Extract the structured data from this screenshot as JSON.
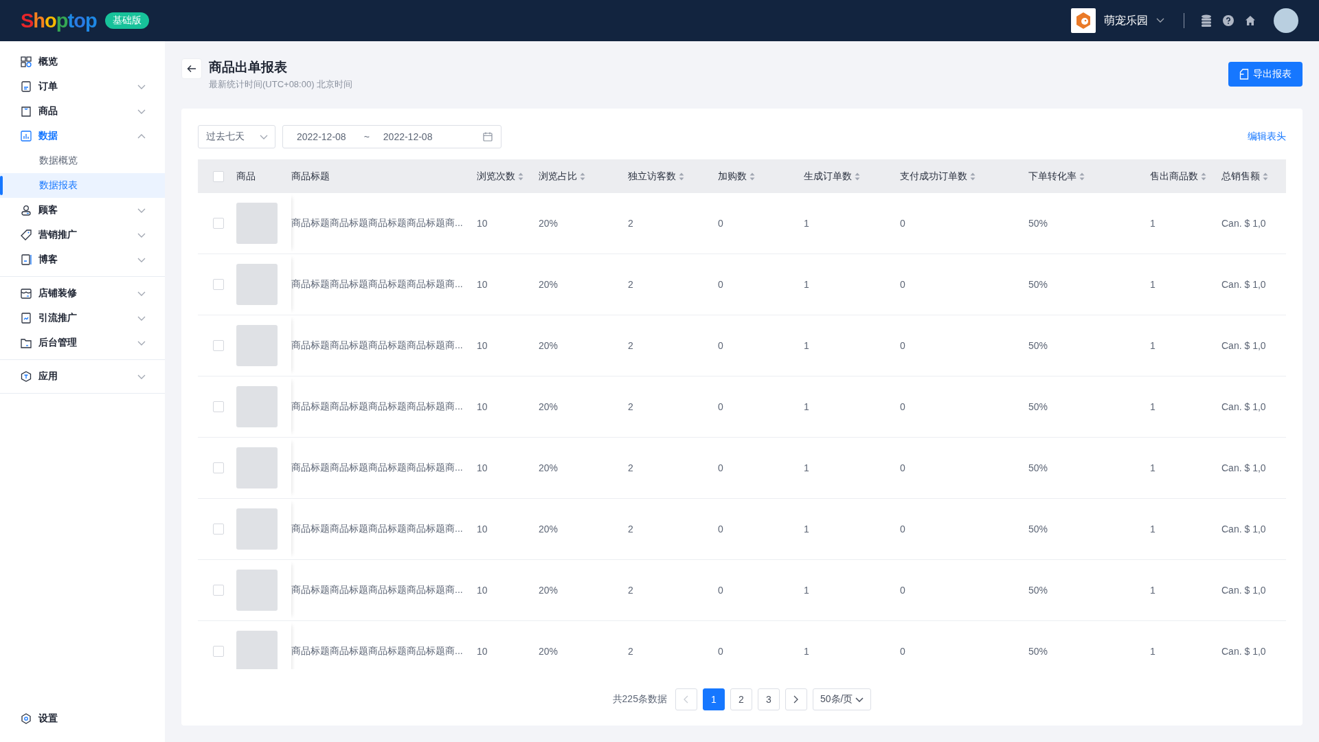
{
  "topbar": {
    "logo": "Shoptop",
    "plan_badge": "基础版",
    "store_name": "萌宠乐园"
  },
  "sidebar": {
    "groups": [
      {
        "items": [
          {
            "label": "概览",
            "kind": "link",
            "selected": false
          },
          {
            "label": "订单",
            "kind": "menu",
            "expanded": false,
            "selected": false
          },
          {
            "label": "商品",
            "kind": "menu",
            "expanded": false,
            "selected": false
          },
          {
            "label": "数据",
            "kind": "menu",
            "expanded": true,
            "selected": true,
            "children": [
              {
                "label": "数据概览",
                "selected": false
              },
              {
                "label": "数据报表",
                "selected": true
              }
            ]
          },
          {
            "label": "顾客",
            "kind": "menu",
            "expanded": false,
            "selected": false
          },
          {
            "label": "营销推广",
            "kind": "menu",
            "expanded": false,
            "selected": false
          },
          {
            "label": "博客",
            "kind": "menu",
            "expanded": false,
            "selected": false
          }
        ]
      },
      {
        "items": [
          {
            "label": "店铺装修",
            "kind": "menu",
            "expanded": false,
            "selected": false
          },
          {
            "label": "引流推广",
            "kind": "menu",
            "expanded": false,
            "selected": false
          },
          {
            "label": "后台管理",
            "kind": "menu",
            "expanded": false,
            "selected": false
          }
        ]
      },
      {
        "items": [
          {
            "label": "应用",
            "kind": "menu",
            "expanded": false,
            "selected": false
          }
        ]
      }
    ],
    "footer": {
      "label": "设置",
      "selected": false
    }
  },
  "page": {
    "title": "商品出单报表",
    "subtitle": "最新统计时间(UTC+08:00) 北京时间",
    "export_button": "导出报表"
  },
  "filters": {
    "range": "过去七天",
    "date_start": "2022-12-08",
    "date_separator": "~",
    "date_end": "2022-12-08",
    "edit_columns_link": "编辑表头"
  },
  "table": {
    "all_checked": false,
    "columns": [
      {
        "label": "商品",
        "sortable": false
      },
      {
        "label": "商品标题",
        "sortable": false
      },
      {
        "label": "浏览次数",
        "sortable": true
      },
      {
        "label": "浏览占比",
        "sortable": true
      },
      {
        "label": "独立访客数",
        "sortable": true
      },
      {
        "label": "加购数",
        "sortable": true
      },
      {
        "label": "生成订单数",
        "sortable": true
      },
      {
        "label": "支付成功订单数",
        "sortable": true
      },
      {
        "label": "下单转化率",
        "sortable": true
      },
      {
        "label": "售出商品数",
        "sortable": true
      },
      {
        "label": "总销售额",
        "sortable": true
      }
    ],
    "rows": [
      {
        "checked": false,
        "cells": [
          "",
          "商品标题商品标题商品标题商品标题商...",
          "10",
          "20%",
          "2",
          "0",
          "1",
          "0",
          "50%",
          "1",
          "Can. $ 1,0"
        ]
      },
      {
        "checked": false,
        "cells": [
          "",
          "商品标题商品标题商品标题商品标题商...",
          "10",
          "20%",
          "2",
          "0",
          "1",
          "0",
          "50%",
          "1",
          "Can. $ 1,0"
        ]
      },
      {
        "checked": false,
        "cells": [
          "",
          "商品标题商品标题商品标题商品标题商...",
          "10",
          "20%",
          "2",
          "0",
          "1",
          "0",
          "50%",
          "1",
          "Can. $ 1,0"
        ]
      },
      {
        "checked": false,
        "cells": [
          "",
          "商品标题商品标题商品标题商品标题商...",
          "10",
          "20%",
          "2",
          "0",
          "1",
          "0",
          "50%",
          "1",
          "Can. $ 1,0"
        ]
      },
      {
        "checked": false,
        "cells": [
          "",
          "商品标题商品标题商品标题商品标题商...",
          "10",
          "20%",
          "2",
          "0",
          "1",
          "0",
          "50%",
          "1",
          "Can. $ 1,0"
        ]
      },
      {
        "checked": false,
        "cells": [
          "",
          "商品标题商品标题商品标题商品标题商...",
          "10",
          "20%",
          "2",
          "0",
          "1",
          "0",
          "50%",
          "1",
          "Can. $ 1,0"
        ]
      },
      {
        "checked": false,
        "cells": [
          "",
          "商品标题商品标题商品标题商品标题商...",
          "10",
          "20%",
          "2",
          "0",
          "1",
          "0",
          "50%",
          "1",
          "Can. $ 1,0"
        ]
      },
      {
        "checked": false,
        "cells": [
          "",
          "商品标题商品标题商品标题商品标题商...",
          "10",
          "20%",
          "2",
          "0",
          "1",
          "0",
          "50%",
          "1",
          "Can. $ 1,0"
        ]
      }
    ]
  },
  "pagination": {
    "total": "共225条数据",
    "prev_disabled": true,
    "next_disabled": false,
    "pages": [
      {
        "label": "1",
        "selected": true
      },
      {
        "label": "2",
        "selected": false
      },
      {
        "label": "3",
        "selected": false
      }
    ],
    "page_size": "50条/页"
  }
}
